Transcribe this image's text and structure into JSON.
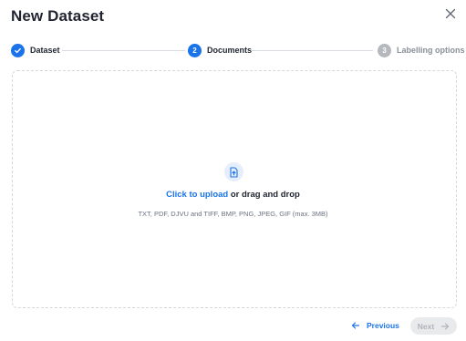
{
  "dialog": {
    "title": "New Dataset",
    "close_icon": "close-icon"
  },
  "stepper": {
    "steps": [
      {
        "label": "Dataset",
        "number": "1",
        "state": "completed",
        "icon": "check-icon"
      },
      {
        "label": "Documents",
        "number": "2",
        "state": "active"
      },
      {
        "label": "Labelling options",
        "number": "3",
        "state": "pending"
      }
    ]
  },
  "upload": {
    "icon": "file-upload-icon",
    "link_text": "Click to upload",
    "rest_text": " or drag and drop",
    "formats": "TXT, PDF, DJVU and TIFF, BMP, PNG, JPEG, GIF (max. 3MB)"
  },
  "footer": {
    "previous_label": "Previous",
    "next_label": "Next",
    "next_disabled": true
  },
  "colors": {
    "accent": "#1a73e8",
    "pending": "#b5b8bd",
    "disabled_bg": "#e9eaec"
  }
}
